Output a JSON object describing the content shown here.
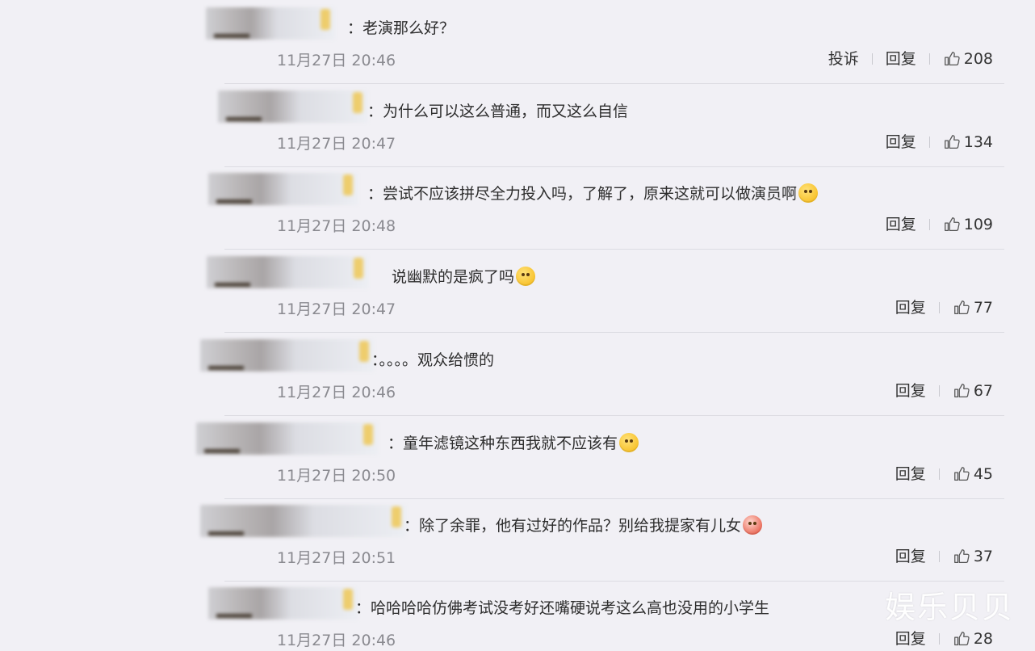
{
  "comments": [
    {
      "text": "：老演那么好？",
      "emoji": null,
      "time": "11月27日 20:46",
      "report_label": "投诉",
      "reply_label": "回复",
      "likes": "208"
    },
    {
      "text": "：为什么可以这么普通，而又这么自信",
      "emoji": null,
      "time": "11月27日 20:47",
      "report_label": "",
      "reply_label": "回复",
      "likes": "134"
    },
    {
      "text": "：尝试不应该拼尽全力投入吗，了解了，原来这就可以做演员啊",
      "emoji": "shy-face-emoji",
      "time": "11月27日 20:48",
      "report_label": "",
      "reply_label": "回复",
      "likes": "109"
    },
    {
      "text": "说幽默的是疯了吗",
      "emoji": "shocked-face-emoji",
      "time": "11月27日 20:47",
      "report_label": "",
      "reply_label": "回复",
      "likes": "77"
    },
    {
      "text": "：。。。。观众给惯的",
      "emoji": null,
      "time": "11月27日 20:46",
      "report_label": "",
      "reply_label": "回复",
      "likes": "67"
    },
    {
      "text": "：童年滤镜这种东西我就不应该有",
      "emoji": "thinking-face-emoji",
      "time": "11月27日 20:50",
      "report_label": "",
      "reply_label": "回复",
      "likes": "45"
    },
    {
      "text": "：除了余罪，他有过好的作品？别给我提家有儿女",
      "emoji": "angry-face-emoji",
      "time": "11月27日 20:51",
      "report_label": "",
      "reply_label": "回复",
      "likes": "37"
    },
    {
      "text": "：哈哈哈哈仿佛考试没考好还嘴硬说考这么高也没用的小学生",
      "emoji": null,
      "time": "11月27日 20:46",
      "report_label": "",
      "reply_label": "回复",
      "likes": "28"
    }
  ],
  "watermark": "娱乐贝贝",
  "colors": {
    "background": "#f1f0f5",
    "text": "#2d2d2d",
    "time": "#8a8a90",
    "divider": "#dcdce2"
  }
}
